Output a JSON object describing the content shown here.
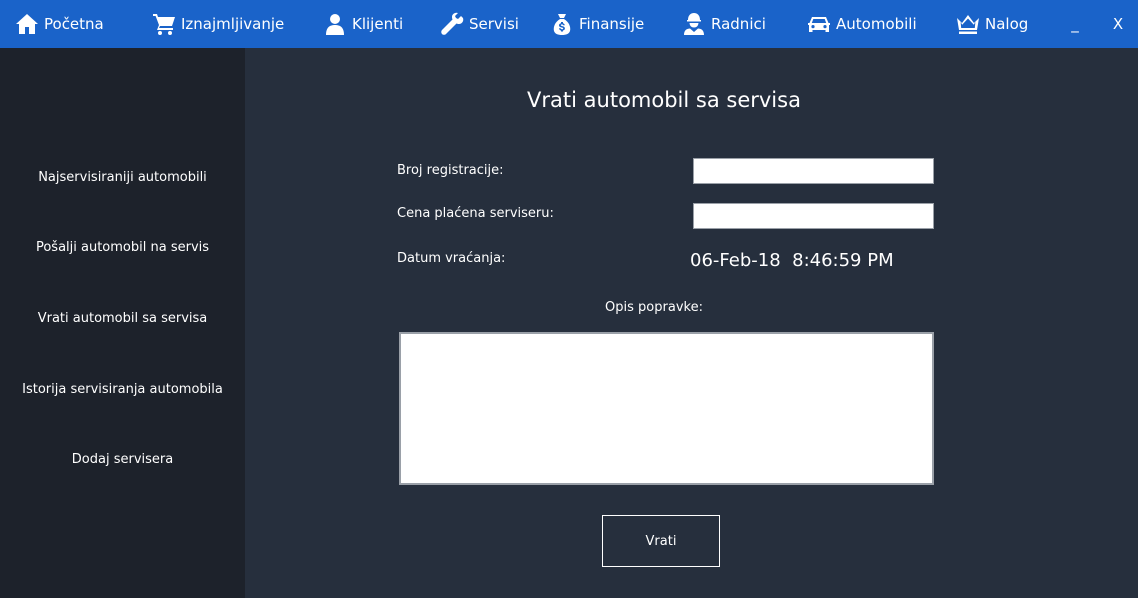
{
  "nav": {
    "items": [
      {
        "label": "Početna",
        "icon": "home-icon"
      },
      {
        "label": "Iznajmljivanje",
        "icon": "cart-icon"
      },
      {
        "label": "Klijenti",
        "icon": "user-icon"
      },
      {
        "label": "Servisi",
        "icon": "wrench-icon"
      },
      {
        "label": "Finansije",
        "icon": "money-bag-icon"
      },
      {
        "label": "Radnici",
        "icon": "worker-icon"
      },
      {
        "label": "Automobili",
        "icon": "car-icon"
      },
      {
        "label": "Nalog",
        "icon": "crown-icon"
      }
    ],
    "minimize_label": "_",
    "close_label": "X"
  },
  "sidebar": {
    "items": [
      {
        "label": "Najservisiraniji automobili"
      },
      {
        "label": "Pošalji automobil na servis"
      },
      {
        "label": "Vrati automobil sa servisa"
      },
      {
        "label": "Istorija servisiranja automobila"
      },
      {
        "label": "Dodaj servisera"
      }
    ]
  },
  "form": {
    "title": "Vrati automobil sa servisa",
    "registration_label": "Broj registracije:",
    "registration_value": "",
    "price_label": "Cena plaćena serviseru:",
    "price_value": "",
    "date_label": "Datum vraćanja:",
    "date_value": "06-Feb-18  8:46:59 PM",
    "description_label": "Opis popravke:",
    "description_value": "",
    "submit_label": "Vrati"
  },
  "colors": {
    "topbar": "#1a63c9",
    "sidebar": "#1d222b",
    "main": "#262f3d"
  }
}
